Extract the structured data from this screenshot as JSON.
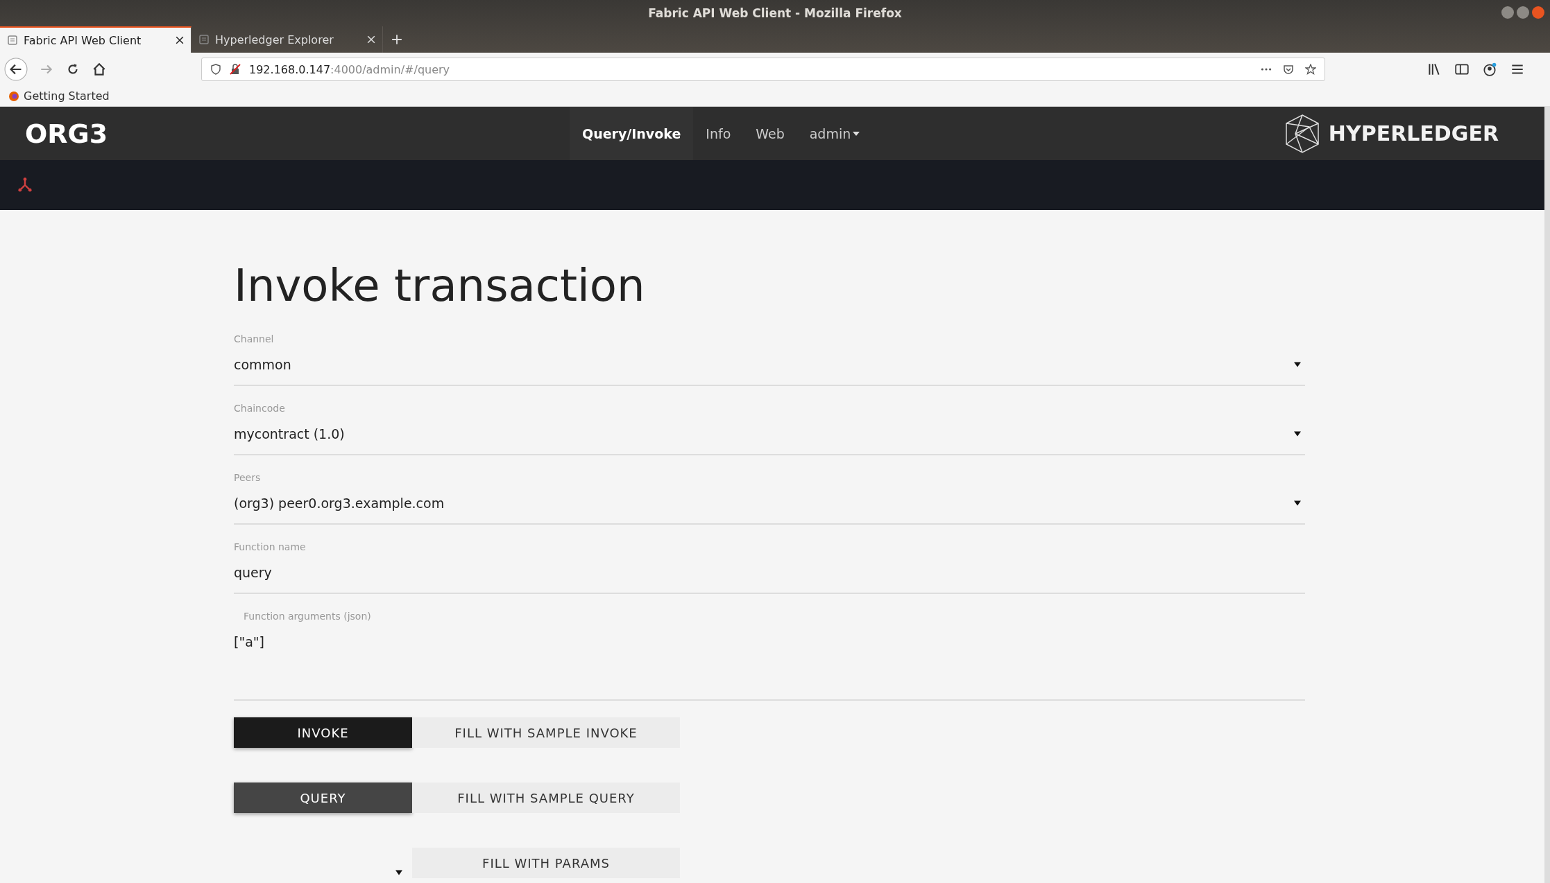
{
  "browser": {
    "title": "Fabric API Web Client - Mozilla Firefox",
    "tabs": [
      {
        "label": "Fabric API Web Client",
        "selected": true
      },
      {
        "label": "Hyperledger Explorer",
        "selected": false
      }
    ],
    "url": {
      "host": "192.168.0.147",
      "rest": ":4000/admin/#/query"
    },
    "bookmarks": [
      "Getting Started"
    ]
  },
  "app": {
    "brand": "ORG3",
    "nav": [
      {
        "label": "Query/Invoke",
        "selected": true,
        "kind": "link"
      },
      {
        "label": "Info",
        "selected": false,
        "kind": "link"
      },
      {
        "label": "Web",
        "selected": false,
        "kind": "link"
      },
      {
        "label": "admin",
        "selected": false,
        "kind": "dropdown"
      }
    ],
    "logo": "HYPERLEDGER"
  },
  "form": {
    "heading": "Invoke transaction",
    "fields": [
      {
        "label": "Channel",
        "value": "common",
        "kind": "select"
      },
      {
        "label": "Chaincode",
        "value": "mycontract (1.0)",
        "kind": "select"
      },
      {
        "label": "Peers",
        "value": "(org3) peer0.org3.example.com",
        "kind": "select"
      },
      {
        "label": "Function name",
        "value": "query",
        "kind": "text"
      },
      {
        "label": "Function arguments (json)",
        "value": "[\"a\"]",
        "kind": "textarea"
      }
    ],
    "action_rows": [
      [
        {
          "kind": "invoke",
          "label": "INVOKE"
        },
        {
          "kind": "fill",
          "label": "FILL WITH SAMPLE INVOKE"
        }
      ],
      [
        {
          "kind": "query",
          "label": "QUERY"
        },
        {
          "kind": "fill",
          "label": "FILL WITH SAMPLE QUERY"
        }
      ],
      [
        {
          "kind": "select"
        },
        {
          "kind": "fill",
          "label": "FILL WITH PARAMS"
        }
      ]
    ]
  }
}
